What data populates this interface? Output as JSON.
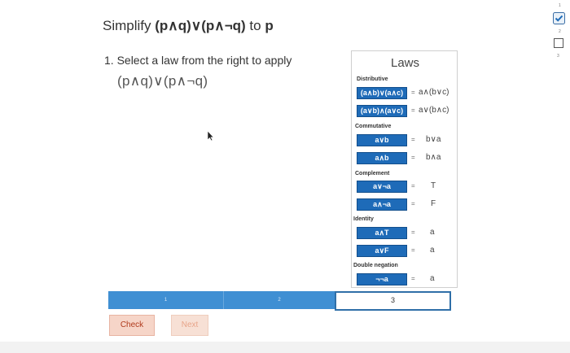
{
  "problem": {
    "title_prefix": "Simplify ",
    "title_expr": "(p∧q)∨(p∧¬q)",
    "title_to": " to ",
    "title_target": "p",
    "step_label": "1. Select a law from the right to apply",
    "current_expression": "(p∧q)∨(p∧¬q)"
  },
  "laws": {
    "title": "Laws",
    "equals": "=",
    "sections": {
      "distributive": "Distributive",
      "commutative": "Commutative",
      "complement": "Complement",
      "identity": "Identity",
      "double_negation": "Double negation"
    },
    "distributive": [
      {
        "lhs": "(a∧b)∨(a∧c)",
        "rhs": "a∧(b∨c)"
      },
      {
        "lhs": "(a∨b)∧(a∨c)",
        "rhs": "a∨(b∧c)"
      }
    ],
    "commutative": [
      {
        "lhs": "a∨b",
        "rhs": "b∨a"
      },
      {
        "lhs": "a∧b",
        "rhs": "b∧a"
      }
    ],
    "complement": [
      {
        "lhs": "a∨¬a",
        "rhs": "T"
      },
      {
        "lhs": "a∧¬a",
        "rhs": "F"
      }
    ],
    "identity": [
      {
        "lhs": "a∧T",
        "rhs": "a"
      },
      {
        "lhs": "a∨F",
        "rhs": "a"
      }
    ],
    "double_negation": [
      {
        "lhs": "¬¬a",
        "rhs": "a"
      }
    ]
  },
  "progress": {
    "segments": [
      "1",
      "2",
      "3"
    ],
    "current": 3
  },
  "buttons": {
    "check": "Check",
    "next": "Next"
  },
  "side_panel": {
    "numbers": [
      "1",
      "2",
      "3"
    ],
    "first_status": "check-icon"
  },
  "colors": {
    "law_button": "#1e6bb8",
    "progress_fill": "#3f8fd3",
    "check_text": "#b03a1c",
    "next_text": "#e8a48a"
  }
}
